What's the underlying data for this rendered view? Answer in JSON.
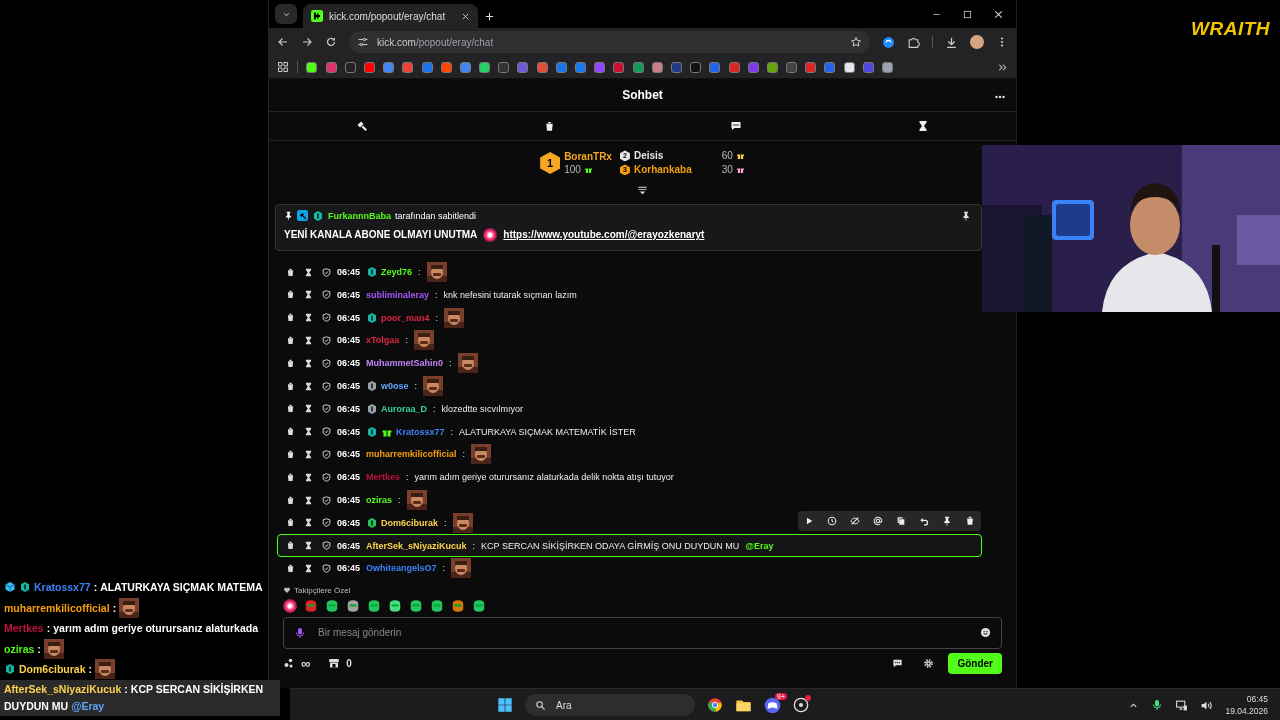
{
  "stream_logo": "WRAITH",
  "browser": {
    "tab_title": "kick.com/popout/eray/chat",
    "url_host": "kick.com",
    "url_path": "/popout/eray/chat"
  },
  "chat": {
    "title": "Sohbet",
    "leaderboard": [
      {
        "rank": "1",
        "name": "BoranTRx",
        "amount": "100",
        "color": "#f5a623"
      },
      {
        "rank": "2",
        "name": "Deisis",
        "amount": "60",
        "color": "#e5e7eb"
      },
      {
        "rank": "3",
        "name": "Korhankaba",
        "amount": "30",
        "color": "#f59e0b"
      }
    ],
    "pinned": {
      "by_user": "FurkannnBaba",
      "by_text": "tarafından sabitlendi",
      "message": "YENİ KANALA ABONE OLMAYI UNUTMA",
      "link": "https://www.youtube.com/@erayozkenaryt"
    },
    "messages": [
      {
        "time": "06:45",
        "user": "Zeyd76",
        "color": "#53fc18",
        "badges": [
          {
            "kind": "sub"
          }
        ],
        "separator": ":",
        "emote": true,
        "selected": false
      },
      {
        "time": "06:45",
        "user": "subliminaleray",
        "color": "#a855f7",
        "separator": ":",
        "text": "knk nefesini tutarak sıçman lazım",
        "selected": false
      },
      {
        "time": "06:45",
        "user": "poor_man4",
        "color": "#dc2640",
        "badges": [
          {
            "kind": "sub"
          }
        ],
        "separator": ":",
        "emote": true,
        "selected": false
      },
      {
        "time": "06:45",
        "user": "xTolgaa",
        "color": "#dc2640",
        "separator": ":",
        "emote": true,
        "selected": false
      },
      {
        "time": "06:45",
        "user": "MuhammetSahin0",
        "color": "#c084fc",
        "separator": ":",
        "emote": true,
        "selected": false
      },
      {
        "time": "06:45",
        "user": "w0ose",
        "color": "#60a5fa",
        "badges": [
          {
            "kind": "gray"
          }
        ],
        "separator": ":",
        "emote": true,
        "selected": false
      },
      {
        "time": "06:45",
        "user": "Auroraa_D",
        "color": "#34d399",
        "badges": [
          {
            "kind": "gray"
          }
        ],
        "separator": ":",
        "text": "klozedtte sıcvılmıyor",
        "selected": false
      },
      {
        "time": "06:45",
        "user": "Kratossx77",
        "color": "#3b82f6",
        "badges": [
          {
            "kind": "sub"
          },
          {
            "kind": "gift"
          }
        ],
        "separator": ":",
        "text": "ALATURKAYA SIÇMAK MATEMATİK İSTER",
        "selected": false
      },
      {
        "time": "06:45",
        "user": "muharremkilicofficial",
        "color": "#f59e0b",
        "separator": ":",
        "emote": true,
        "selected": false
      },
      {
        "time": "06:45",
        "user": "Mertkes",
        "color": "#be123c",
        "separator": ":",
        "text": "yarım adım geriye oturursanız alaturkada delik nokta atışı tutuyor",
        "selected": false
      },
      {
        "time": "06:45",
        "user": "oziras",
        "color": "#53fc18",
        "separator": ":",
        "emote": true,
        "selected": false
      },
      {
        "time": "06:45",
        "user": "Dom6ciburak",
        "color": "#fcd34d",
        "badges": [
          {
            "kind": "green"
          }
        ],
        "separator": ":",
        "emote": true,
        "selected": false
      },
      {
        "time": "06:45",
        "user": "AfterSek_sNiyaziKucuk",
        "color": "#fcd34d",
        "separator": ":",
        "text": "KCP SERCAN SİKİŞİRKEN ODAYA GİRMİŞ ONU DUYDUN MU",
        "mention": "@Eray",
        "selected": true
      },
      {
        "time": "06:45",
        "user": "OwhiteangelsO7",
        "color": "#3b82f6",
        "separator": ":",
        "emote": true,
        "selected": false
      }
    ],
    "followers_label": "Takipçilere Özel",
    "input_placeholder": "Bir mesaj gönderin",
    "points": "∞",
    "store_count": "0",
    "send_label": "Gönder"
  },
  "overlay_chat": [
    {
      "user": "Kratossx77",
      "color": "#3b82f6",
      "badges": [
        {
          "kind": "cube"
        },
        {
          "kind": "sub"
        }
      ],
      "separator": ":",
      "text": "ALATURKAYA SIÇMAK MATEMA"
    },
    {
      "user": "muharremkilicofficial",
      "color": "#f59e0b",
      "separator": ":",
      "emote": true
    },
    {
      "user": "Mertkes",
      "color": "#be123c",
      "separator": ":",
      "text": "yarım adım geriye oturursanız alaturkada"
    },
    {
      "user": "oziras",
      "color": "#53fc18",
      "separator": ":",
      "emote": true
    },
    {
      "user": "Dom6ciburak",
      "color": "#fcd34d",
      "badges": [
        {
          "kind": "sub"
        }
      ],
      "separator": ":",
      "emote": true
    },
    {
      "user": "AfterSek_sNiyaziKucuk",
      "color": "#fcd34d",
      "separator": ":",
      "text": "KCP SERCAN SİKİŞİRKEN",
      "continuation": "DUYDUN MU",
      "mention": "@Eray"
    }
  ],
  "taskbar": {
    "search_placeholder": "Ara",
    "discord_badge": "9+",
    "time": "06:45",
    "date": "19.04.2026"
  }
}
